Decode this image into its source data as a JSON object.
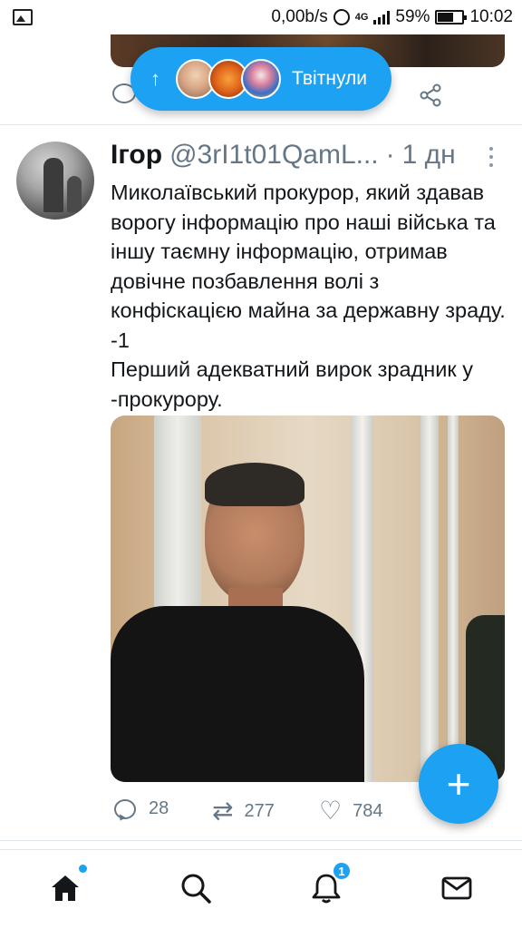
{
  "status_bar": {
    "data_rate": "0,00b/s",
    "network": "4G",
    "battery": "59%",
    "time": "10:02"
  },
  "retweet_pill": {
    "arrow": "↑",
    "label": "Твітнули"
  },
  "tweet": {
    "author": "Ігор",
    "handle": "@3rI1t01QamL...",
    "dot": "·",
    "time": "1 дн",
    "text": "Миколаївський прокурор, який здавав ворогу інформацію про наші війська та іншу таємну інформацію, отримав довічне позбавлення волі з конфіскацією майна за державну зраду. -1\nПерший адекватний вирок зрадник у -прокурору.",
    "counts": {
      "replies": "28",
      "retweets": "277",
      "likes": "784"
    }
  },
  "fab": {
    "label": "+"
  },
  "bottom_nav": {
    "notifications_badge": "1",
    "items": [
      "home-icon",
      "search-icon",
      "bell-icon",
      "mail-icon"
    ]
  },
  "colors": {
    "accent": "#1da1f2",
    "muted": "#657786",
    "text": "#14171a"
  }
}
